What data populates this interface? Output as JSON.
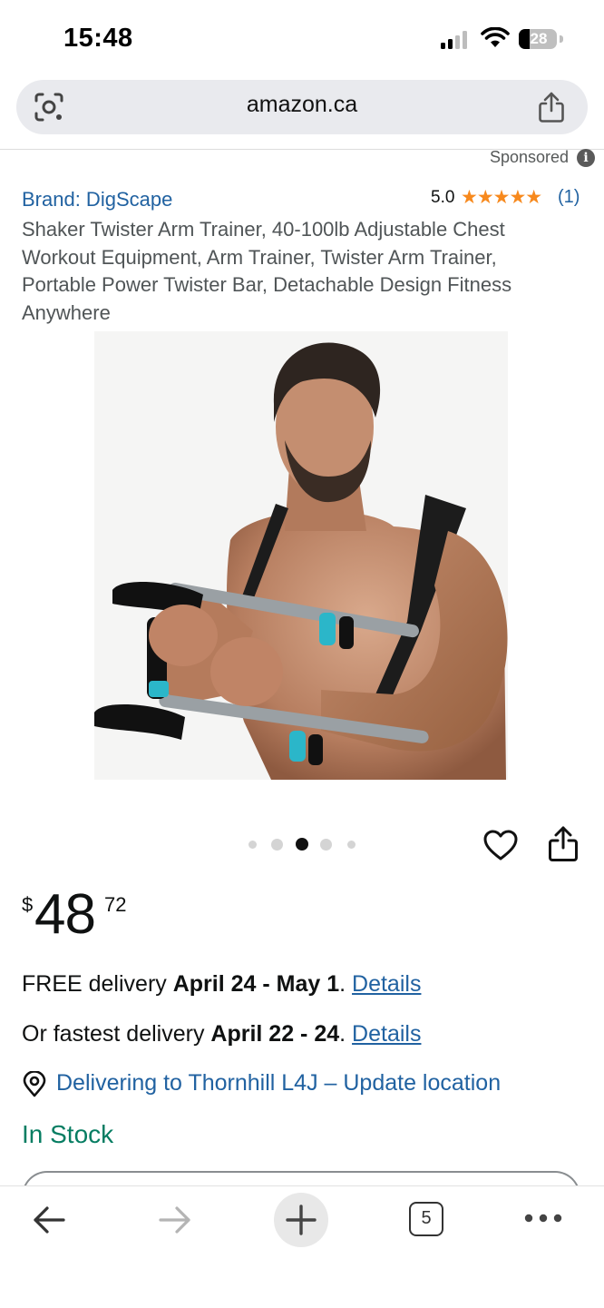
{
  "status_bar": {
    "time": "15:48",
    "battery": "28",
    "icons": [
      "signal-icon",
      "wifi-icon",
      "battery-icon"
    ]
  },
  "browser": {
    "url": "amazon.ca",
    "icons": [
      "lens-icon",
      "share-icon"
    ]
  },
  "product": {
    "sponsored_label": "Sponsored",
    "sponsored_info": "i",
    "brand": "Brand: DigScape",
    "rating_value": "5.0",
    "stars": "★★★★★",
    "star_count": 5,
    "rating_count": "(1)",
    "title": "Shaker Twister Arm Trainer, 40-100lb Adjustable Chest Workout Equipment, Arm Trainer, Twister Arm Trainer, Portable Power Twister Bar, Detachable Design Fitness Anywhere",
    "image_pager": {
      "count": 5,
      "active_index": 2
    },
    "price": {
      "symbol": "$",
      "whole": "48",
      "fraction": "72"
    },
    "delivery": {
      "free_prefix": "FREE delivery ",
      "free_dates": "April 24 - May 1",
      "free_sep": ". ",
      "free_link": "Details",
      "fast_prefix": "Or fastest delivery ",
      "fast_dates": "April 22 - 24",
      "fast_sep": ". ",
      "fast_link": "Details"
    },
    "location": "Delivering to Thornhill L4J – Update location",
    "stock": "In Stock"
  },
  "toolbar": {
    "tabs_count": "5",
    "icons": [
      "back-arrow-icon",
      "forward-arrow-icon",
      "plus-icon",
      "tabs-icon",
      "more-icon"
    ]
  },
  "colors": {
    "link": "#2162a1",
    "star": "#f7891d",
    "in_stock": "#067d62",
    "url_bar": "#e9eaee"
  }
}
